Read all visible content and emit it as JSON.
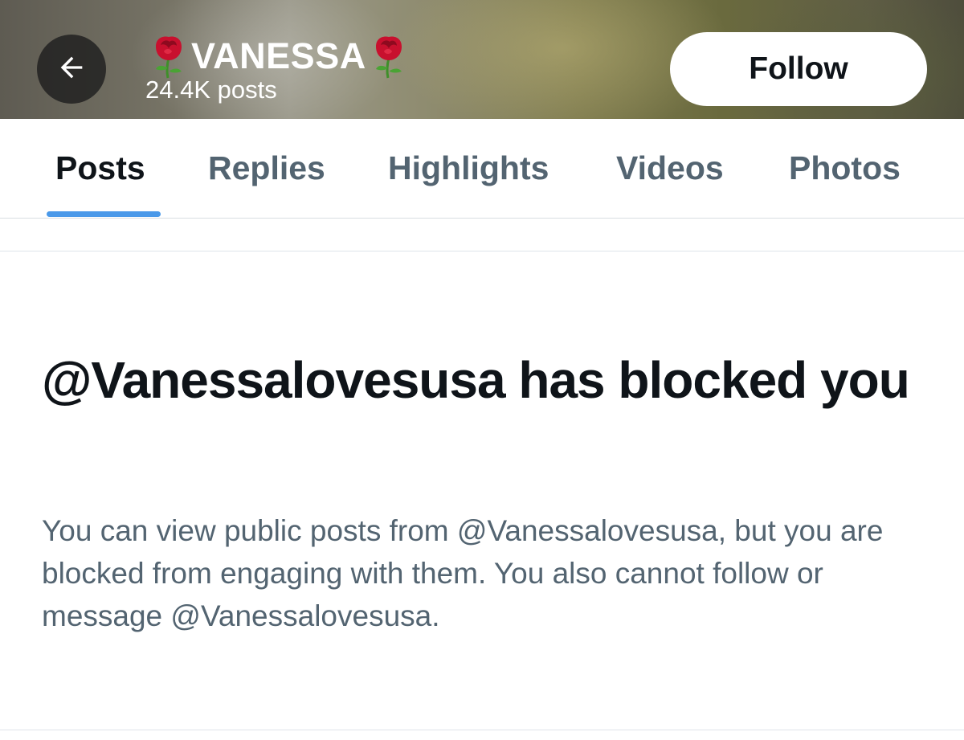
{
  "header": {
    "name": "VANESSA",
    "name_icon": "rose-emoji",
    "post_count": "24.4K posts",
    "back_icon": "arrow-left-icon",
    "follow_label": "Follow"
  },
  "tabs": [
    {
      "label": "Posts",
      "active": true
    },
    {
      "label": "Replies",
      "active": false
    },
    {
      "label": "Highlights",
      "active": false
    },
    {
      "label": "Videos",
      "active": false
    },
    {
      "label": "Photos",
      "active": false
    }
  ],
  "blocked": {
    "title": "@Vanessalovesusa has blocked you",
    "description": "You can view public posts from @Vanessalovesusa, but you are blocked from engaging with them. You also cannot follow or message @Vanessalovesusa."
  },
  "colors": {
    "primary_text": "#0f1419",
    "secondary_text": "#536471",
    "tab_indicator": "#4a99e9",
    "divider": "#dfe4ea"
  }
}
